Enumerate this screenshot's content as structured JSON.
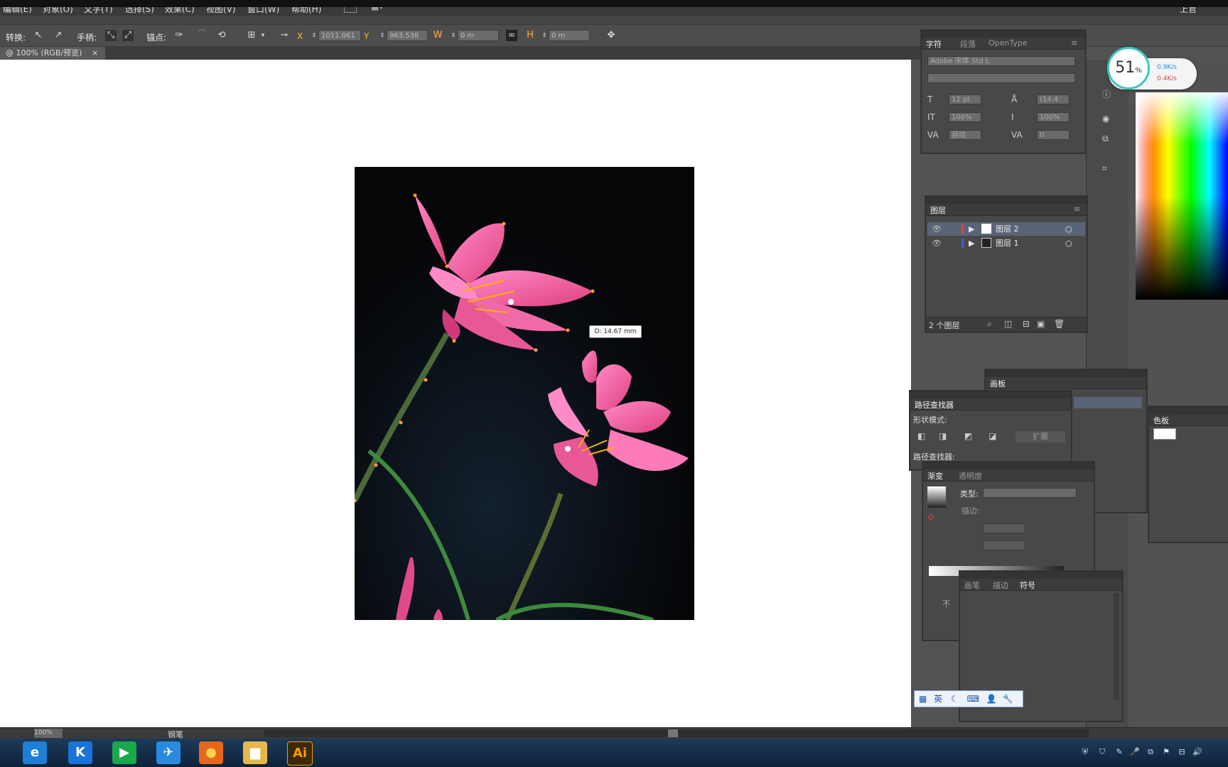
{
  "menubar": {
    "items": [
      "编辑(E)",
      "对象(O)",
      "文字(T)",
      "选择(S)",
      "效果(C)",
      "视图(V)",
      "窗口(W)",
      "帮助(H)"
    ],
    "right_label": "上官"
  },
  "control_bar": {
    "convert_label": "转换:",
    "handles_label": "手柄:",
    "anchors_label": "锚点:",
    "x_value": "1011.061",
    "y_value": "963.538",
    "w_value": "0 m",
    "h_value": "0 m"
  },
  "document_tab": {
    "label": "@ 100% (RGB/预览)",
    "close": "×"
  },
  "canvas": {
    "measure_tooltip": "D: 14.67 mm"
  },
  "character_panel": {
    "tabs": [
      "字符",
      "段落",
      "OpenType"
    ],
    "font_family": "Adobe 宋体 Std L",
    "font_style": "-",
    "font_size": "12 pt",
    "leading": "(14.4",
    "vscale": "100%",
    "hscale": "100%",
    "kerning": "自动",
    "tracking": "0"
  },
  "layers_panel": {
    "tab": "图层",
    "layers": [
      {
        "name": "图层 2",
        "color": "#e04040"
      },
      {
        "name": "图层 1",
        "color": "#4060e0"
      }
    ],
    "footer": "2 个图层"
  },
  "artboards_panel": {
    "tab": "画板"
  },
  "pathfinder_panel": {
    "tab": "路径查找器",
    "shape_modes_label": "形状模式:",
    "expand_label": "扩展",
    "pathfinders_label": "路径查找器:"
  },
  "swatches_panel": {
    "tab": "色板"
  },
  "gradient_panel": {
    "tabs": [
      "渐变",
      "透明度"
    ],
    "type_label": "类型:",
    "stroke_label": "描边:"
  },
  "brushes_panel": {
    "tabs": [
      "画笔",
      "描边",
      "符号"
    ],
    "side_text": "不"
  },
  "statusbar": {
    "zoom_value": "100%",
    "tool_label": "钢笔"
  },
  "speed_widget": {
    "percent": "51",
    "percent_unit": "%",
    "up": "0.9K/s",
    "down": "0.4K/s"
  },
  "ime_bar": {
    "lang": "英"
  },
  "taskbar": {
    "apps": [
      {
        "name": "ie-icon",
        "glyph": "e",
        "bg": "#1e7fd6"
      },
      {
        "name": "k-app-icon",
        "glyph": "K",
        "bg": "#1a73d9"
      },
      {
        "name": "player-icon",
        "glyph": "▶",
        "bg": "#19a84a"
      },
      {
        "name": "bird-icon",
        "glyph": "✈",
        "bg": "#2a8ae0"
      },
      {
        "name": "firefox-icon",
        "glyph": "●",
        "bg": "#e8661c"
      },
      {
        "name": "folder-icon",
        "glyph": "▆",
        "bg": "#e6b84a"
      },
      {
        "name": "illustrator-icon",
        "glyph": "Ai",
        "bg": "#3b2a0a"
      }
    ]
  },
  "colors": {
    "accent_cyan": "#3fc7c1",
    "ai_orange": "#ff9a00"
  }
}
